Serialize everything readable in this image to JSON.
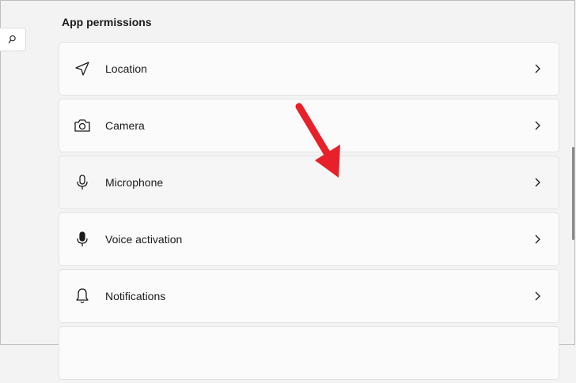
{
  "section": {
    "title": "App permissions"
  },
  "permissions": [
    {
      "label": "Location",
      "icon": "location-arrow-icon"
    },
    {
      "label": "Camera",
      "icon": "camera-icon"
    },
    {
      "label": "Microphone",
      "icon": "microphone-icon"
    },
    {
      "label": "Voice activation",
      "icon": "voice-microphone-icon"
    },
    {
      "label": "Notifications",
      "icon": "bell-icon"
    }
  ],
  "search": {
    "icon": "search-icon"
  },
  "colors": {
    "background": "#f3f3f3",
    "card": "#fbfbfb",
    "card_border": "#e4e4e4",
    "annotation_arrow": "#e8202a",
    "scrollbar_thumb": "#8a8a8a"
  }
}
